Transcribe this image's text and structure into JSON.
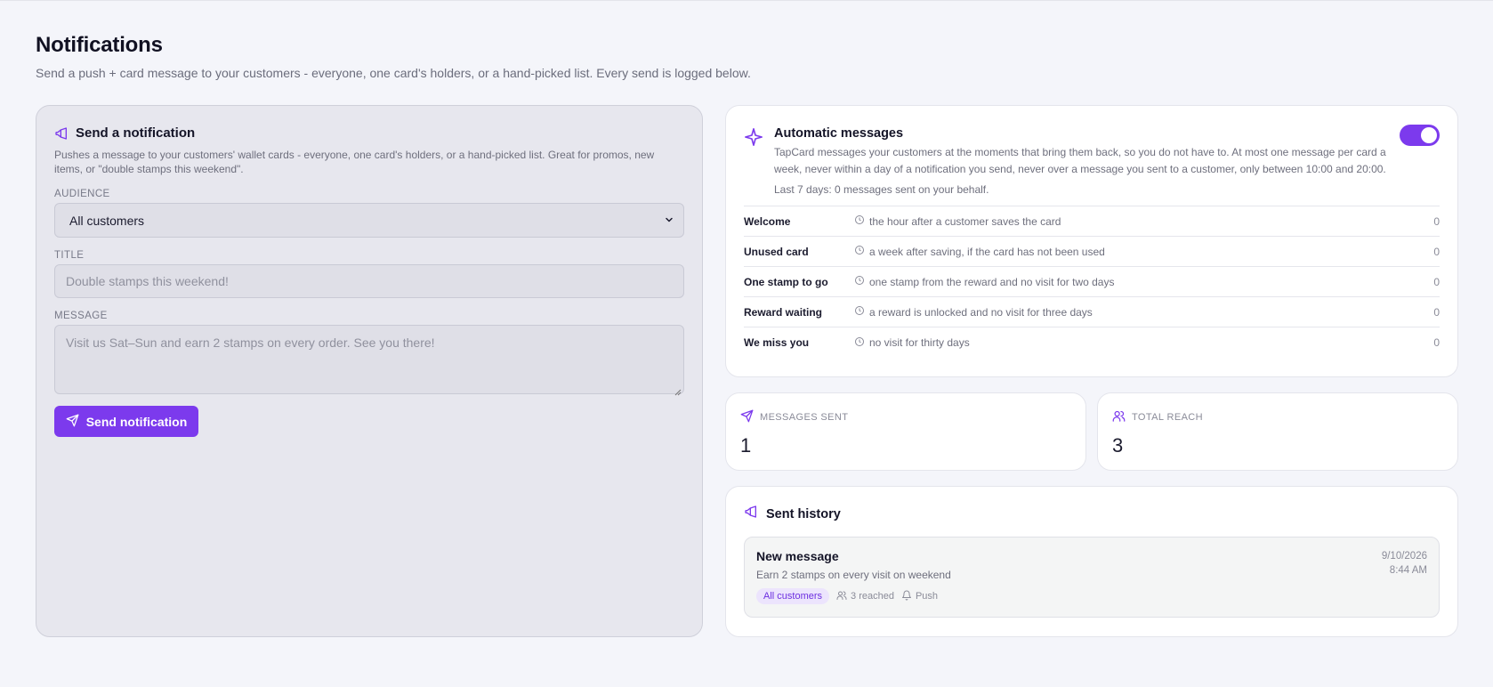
{
  "page": {
    "title": "Notifications",
    "subtitle": "Send a push + card message to your customers - everyone, one card's holders, or a hand-picked list. Every send is logged below."
  },
  "send": {
    "title": "Send a notification",
    "description": "Pushes a message to your customers' wallet cards - everyone, one card's holders, or a hand-picked list. Great for promos, new items, or \"double stamps this weekend\".",
    "audience_label": "AUDIENCE",
    "audience_value": "All customers",
    "title_label": "TITLE",
    "title_placeholder": "Double stamps this weekend!",
    "message_label": "MESSAGE",
    "message_placeholder": "Visit us Sat–Sun and earn 2 stamps on every order. See you there!",
    "button_label": "Send notification"
  },
  "auto": {
    "title": "Automatic messages",
    "description": "TapCard messages your customers at the moments that bring them back, so you do not have to. At most one message per card a week, never within a day of a notification you send, never over a message you sent to a customer, only between 10:00 and 20:00.",
    "stat": "Last 7 days: 0 messages sent on your behalf.",
    "enabled": true,
    "rules": [
      {
        "name": "Welcome",
        "when": "the hour after a customer saves the card",
        "count": "0"
      },
      {
        "name": "Unused card",
        "when": "a week after saving, if the card has not been used",
        "count": "0"
      },
      {
        "name": "One stamp to go",
        "when": "one stamp from the reward and no visit for two days",
        "count": "0"
      },
      {
        "name": "Reward waiting",
        "when": "a reward is unlocked and no visit for three days",
        "count": "0"
      },
      {
        "name": "We miss you",
        "when": "no visit for thirty days",
        "count": "0"
      }
    ]
  },
  "stats": {
    "sent_label": "MESSAGES SENT",
    "sent_value": "1",
    "reach_label": "TOTAL REACH",
    "reach_value": "3"
  },
  "history": {
    "title": "Sent history",
    "items": [
      {
        "name": "New message",
        "body": "Earn 2 stamps on every visit on weekend",
        "date": "9/10/2026",
        "time": "8:44 AM",
        "audience": "All customers",
        "reached": "3 reached",
        "channel": "Push"
      }
    ]
  },
  "colors": {
    "accent": "#7c3aed",
    "background": "#f4f5fa"
  }
}
